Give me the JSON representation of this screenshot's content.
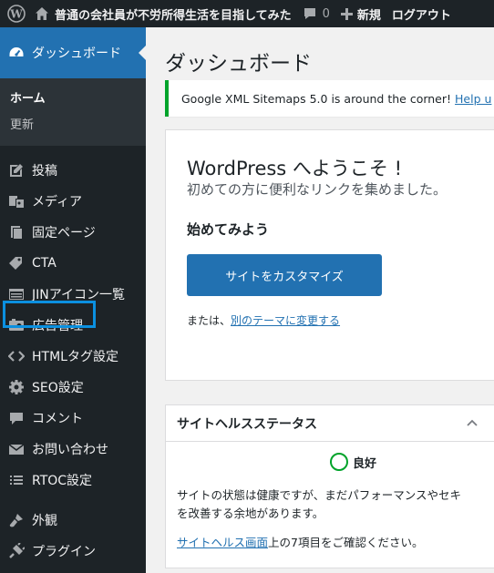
{
  "adminbar": {
    "site_title": "普通の会社員が不労所得生活を目指してみた",
    "comments_count": "0",
    "new_label": "新規",
    "logout_label": "ログアウト"
  },
  "sidebar": {
    "dashboard": "ダッシュボード",
    "sub_home": "ホーム",
    "sub_update": "更新",
    "items": [
      {
        "label": "投稿",
        "icon": "pin-icon"
      },
      {
        "label": "メディア",
        "icon": "media-icon"
      },
      {
        "label": "固定ページ",
        "icon": "page-icon"
      },
      {
        "label": "CTA",
        "icon": "tag-icon"
      },
      {
        "label": "JINアイコン一覧",
        "icon": "list-icon"
      },
      {
        "label": "広告管理",
        "icon": "ad-icon"
      },
      {
        "label": "HTMLタグ設定",
        "icon": "code-icon"
      },
      {
        "label": "SEO設定",
        "icon": "gear-icon"
      },
      {
        "label": "コメント",
        "icon": "comment-icon"
      },
      {
        "label": "お問い合わせ",
        "icon": "mail-icon"
      },
      {
        "label": "RTOC設定",
        "icon": "menu-icon"
      },
      {
        "label": "外観",
        "icon": "brush-icon"
      },
      {
        "label": "プラグイン",
        "icon": "plugin-icon"
      }
    ],
    "highlight_color": "#0b90e0"
  },
  "main": {
    "title": "ダッシュボード",
    "notice_text": "Google XML Sitemaps 5.0 is around the corner!",
    "notice_link": "Help u",
    "welcome": {
      "title": "WordPress へようこそ !",
      "subtitle": "初めての方に便利なリンクを集めました。",
      "heading": "始めてみよう",
      "button": "サイトをカスタマイズ",
      "alt_prefix": "または、",
      "alt_link": "別のテーマに変更する"
    },
    "health": {
      "title": "サイトヘルスステータス",
      "status": "良好",
      "line1": "サイトの状態は健康ですが、まだパフォーマンスやセキ",
      "line2": "を改善する余地があります。",
      "link": "サイトヘルス画面",
      "link_suffix": "上の7項目をご確認ください。"
    }
  },
  "colors": {
    "adminbar_bg": "#1d2327",
    "accent": "#2271b1",
    "notice_success": "#00a32a"
  }
}
